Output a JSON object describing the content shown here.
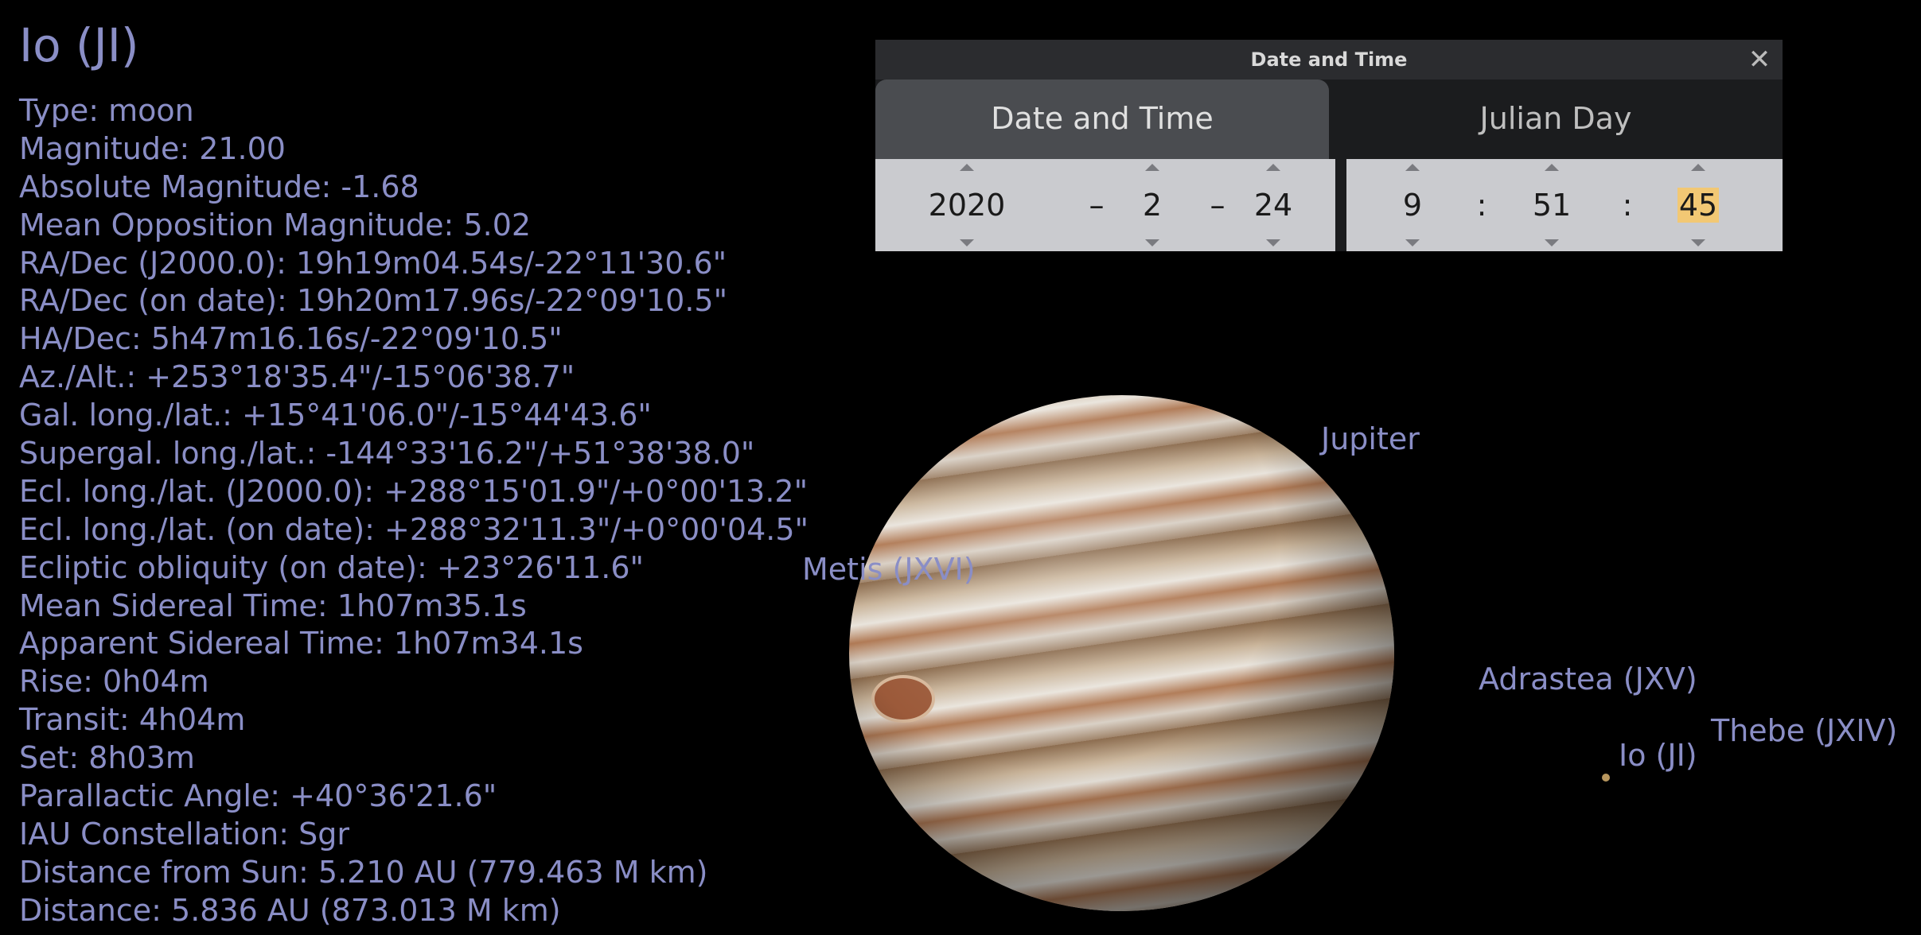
{
  "object": {
    "title": "Io (JI)",
    "lines": [
      "Type: moon",
      "Magnitude: 21.00",
      "Absolute Magnitude: -1.68",
      "Mean Opposition Magnitude: 5.02",
      "RA/Dec (J2000.0): 19h19m04.54s/-22°11'30.6\"",
      "RA/Dec (on date): 19h20m17.96s/-22°09'10.5\"",
      "HA/Dec: 5h47m16.16s/-22°09'10.5\"",
      "Az./Alt.: +253°18'35.4\"/-15°06'38.7\"",
      "Gal. long./lat.: +15°41'06.0\"/-15°44'43.6\"",
      "Supergal. long./lat.: -144°33'16.2\"/+51°38'38.0\"",
      "Ecl. long./lat. (J2000.0): +288°15'01.9\"/+0°00'13.2\"",
      "Ecl. long./lat. (on date): +288°32'11.3\"/+0°00'04.5\"",
      "Ecliptic obliquity (on date): +23°26'11.6\"",
      "Mean Sidereal Time: 1h07m35.1s",
      "Apparent Sidereal Time: 1h07m34.1s",
      "Rise: 0h04m",
      "Transit: 4h04m",
      "Set: 8h03m",
      "Parallactic Angle: +40°36'21.6\"",
      "IAU Constellation: Sgr",
      "Distance from Sun: 5.210 AU (779.463 M km)",
      "Distance: 5.836 AU (873.013 M km)"
    ]
  },
  "sky_labels": {
    "jupiter": "Jupiter",
    "metis": "Metis (JXVI)",
    "adrastea": "Adrastea (JXV)",
    "thebe": "Thebe (JXIV)",
    "io": "Io (JI)"
  },
  "dialog": {
    "title": "Date and Time",
    "close_icon": "close-icon",
    "tabs": [
      "Date and Time",
      "Julian Day"
    ],
    "active_tab": 0,
    "date": {
      "year": "2020",
      "month": "2",
      "day": "24",
      "separator": "–"
    },
    "time": {
      "hour": "9",
      "minute": "51",
      "second": "45",
      "separator": ":"
    },
    "selected_field": "second"
  },
  "colors": {
    "label": "#8a8ec6",
    "background": "#000000",
    "dialog_bg": "#1b1c1e",
    "spin_bg": "#cacbcf",
    "selection": "#f2c874"
  }
}
